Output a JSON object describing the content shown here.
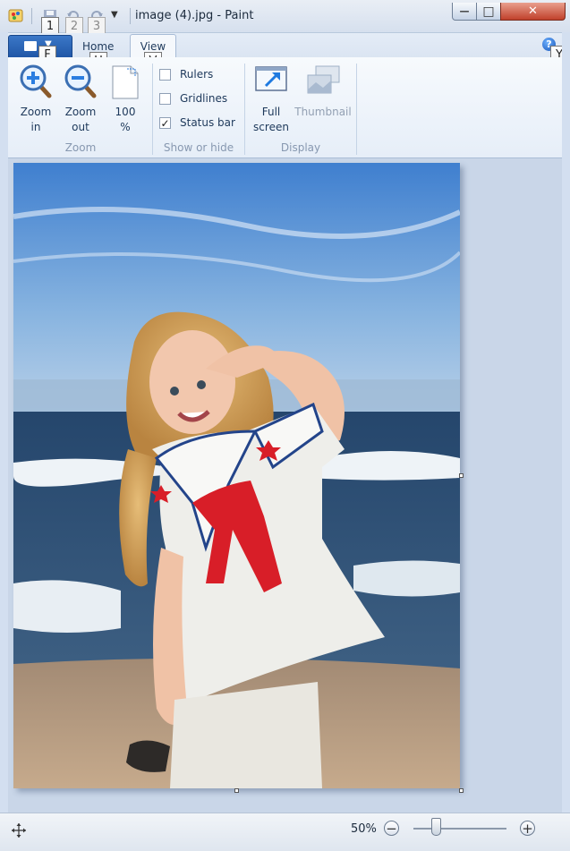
{
  "window": {
    "title": "image (4).jpg - Paint",
    "minimize_glyph": "—",
    "maximize_glyph": "□",
    "close_glyph": "✕"
  },
  "keytips": {
    "qa1": "1",
    "qa2": "2",
    "qa3": "3",
    "file": "F",
    "home": "H",
    "view": "V",
    "help": "Y"
  },
  "tabs": {
    "home": "Home",
    "view": "View"
  },
  "ribbon": {
    "zoom_group": {
      "label": "Zoom",
      "zoom_in": [
        "Zoom",
        "in"
      ],
      "zoom_out": [
        "Zoom",
        "out"
      ],
      "hundred": [
        "100",
        "%"
      ]
    },
    "show_hide_group": {
      "label": "Show or hide",
      "rulers": "Rulers",
      "gridlines": "Gridlines",
      "status_bar": "Status bar",
      "status_bar_checked": true,
      "check_glyph": "✓"
    },
    "display_group": {
      "label": "Display",
      "full_screen": [
        "Full",
        "screen"
      ],
      "thumbnail": "Thumbnail"
    }
  },
  "status": {
    "zoom_level": "50%",
    "zoom_fraction": 0.5,
    "zoom_out_glyph": "−",
    "zoom_in_glyph": "+"
  },
  "colors": {
    "file_tab": "#2a66b8",
    "sky": "#3f7fcf",
    "ocean": "#2b4a6f",
    "sand": "#b79a7e",
    "dress": "#eeeeea",
    "scarf": "#d81e28",
    "hair": "#d9a55a"
  }
}
